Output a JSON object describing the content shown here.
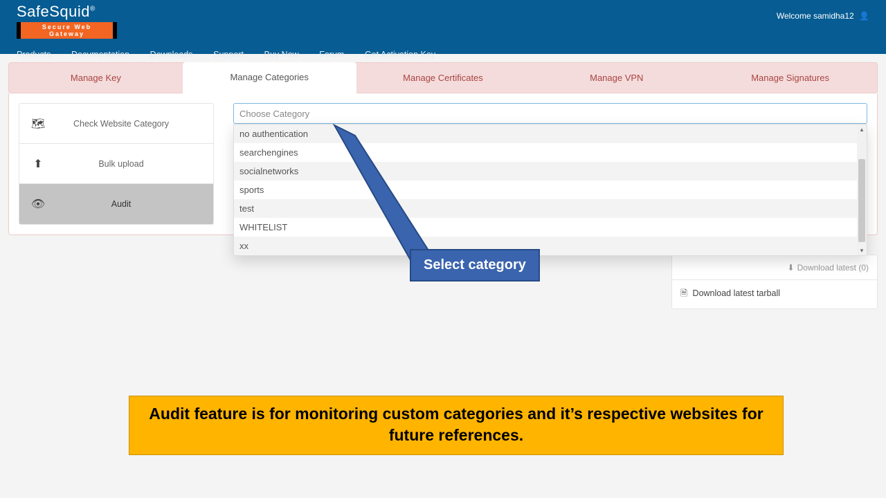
{
  "brand": {
    "name": "SafeSquid",
    "reg": "®",
    "tagline": "Secure Web Gateway"
  },
  "welcome": {
    "prefix": "Welcome ",
    "user": "samidha12"
  },
  "topnav": [
    "Products",
    "Documentation",
    "Downloads",
    "Support",
    "Buy Now",
    "Forum",
    "Get Activation Key"
  ],
  "tabs": [
    "Manage Key",
    "Manage Categories",
    "Manage Certificates",
    "Manage VPN",
    "Manage Signatures"
  ],
  "active_tab": 1,
  "sidebar": [
    {
      "icon": "⌬",
      "label": "Check Website Category"
    },
    {
      "icon": "⬆",
      "label": "Bulk upload"
    },
    {
      "icon": "👁",
      "label": "Audit"
    }
  ],
  "active_side": 2,
  "combo_placeholder": "Choose Category",
  "options": [
    "no authentication",
    "searchengines",
    "socialnetworks",
    "sports",
    "test",
    "WHITELIST",
    "xx"
  ],
  "download": {
    "head_hint": "Download latest (0)",
    "body": "Download latest tarball"
  },
  "callout": "Select category",
  "banner": "Audit feature is for monitoring custom categories and it’s respective websites for future references."
}
